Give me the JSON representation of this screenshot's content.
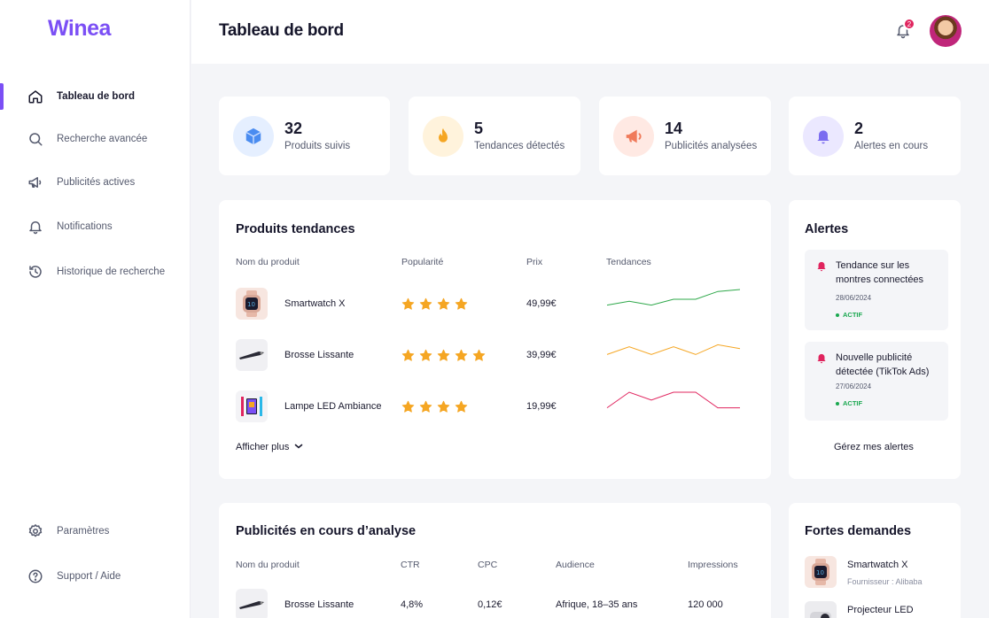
{
  "brand": {
    "name": "Winea",
    "color": "#7b4ff5"
  },
  "sidebar": {
    "items": [
      {
        "label": "Tableau de bord",
        "icon": "home-icon",
        "active": true
      },
      {
        "label": "Recherche avancée",
        "icon": "search-icon"
      },
      {
        "label": "Publicités actives",
        "icon": "megaphone-icon"
      },
      {
        "label": "Notifications",
        "icon": "bell-icon"
      },
      {
        "label": "Historique de recherche",
        "icon": "history-icon"
      }
    ],
    "bottom": [
      {
        "label": "Paramètres",
        "icon": "gear-icon"
      },
      {
        "label": "Support / Aide",
        "icon": "help-icon"
      }
    ]
  },
  "header": {
    "title": "Tableau de bord",
    "notification_count": "2"
  },
  "stats": [
    {
      "value": "32",
      "label": "Produits suivis",
      "icon": "box-icon",
      "color": "#4a8cf0"
    },
    {
      "value": "5",
      "label": "Tendances détectés",
      "icon": "flame-icon",
      "color": "#f5a623"
    },
    {
      "value": "14",
      "label": "Publicités analysées",
      "icon": "megaphone-icon",
      "color": "#f07a5a"
    },
    {
      "value": "2",
      "label": "Alertes en cours",
      "icon": "bell-icon",
      "color": "#7b6cf0"
    }
  ],
  "trending": {
    "title": "Produits tendances",
    "headers": {
      "name": "Nom du produit",
      "popularity": "Popularité",
      "price": "Prix",
      "trend": "Tendances"
    },
    "rows": [
      {
        "name": "Smartwatch X",
        "stars": 4,
        "price": "49,99€",
        "trend_color": "#2ea84a",
        "trend": [
          2,
          4,
          2,
          5,
          5,
          9,
          10
        ]
      },
      {
        "name": "Brosse Lissante",
        "stars": 5,
        "price": "39,99€",
        "trend_color": "#f5a623",
        "trend": [
          3,
          7,
          3,
          7,
          3,
          8,
          6
        ]
      },
      {
        "name": "Lampe LED Ambiance",
        "stars": 4,
        "price": "19,99€",
        "trend_color": "#e0245e",
        "trend": [
          2,
          10,
          6,
          10,
          10,
          2,
          2
        ]
      }
    ],
    "more_label": "Afficher plus"
  },
  "alerts": {
    "title": "Alertes",
    "items": [
      {
        "title": "Tendance sur les montres connectées",
        "date": "28/06/2024",
        "status": "ACTIF"
      },
      {
        "title": "Nouvelle publicité détectée (TikTok Ads)",
        "date": "27/06/2024",
        "status": "ACTIF"
      }
    ],
    "manage_label": "Gérez mes alertes"
  },
  "ads": {
    "title": "Publicités en cours d’analyse",
    "headers": {
      "name": "Nom du produit",
      "ctr": "CTR",
      "cpc": "CPC",
      "audience": "Audience",
      "impressions": "Impressions"
    },
    "rows": [
      {
        "name": "Brosse Lissante",
        "ctr": "4,8%",
        "cpc": "0,12€",
        "audience": "Afrique, 18–35 ans",
        "impressions": "120 000"
      }
    ]
  },
  "demand": {
    "title": "Fortes demandes",
    "items": [
      {
        "name": "Smartwatch X",
        "supplier": "Fournisseur : Alibaba"
      },
      {
        "name": "Projecteur LED",
        "supplier": ""
      }
    ]
  }
}
